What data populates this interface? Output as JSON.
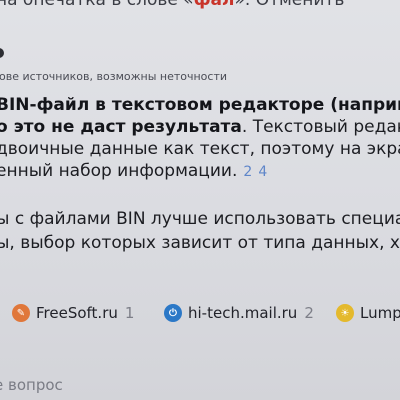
{
  "spellcheck": {
    "prefix": "на опечатка в слове «",
    "word": "фал",
    "suffix": "». ",
    "undo": "Отменить"
  },
  "disclaimer": "ове источников, возможны неточности",
  "answer": {
    "line1_bold": "BIN-файл в текстовом редакторе (например, «Бл",
    "line2_bold": "о это не даст результата",
    "line2_rest": ". Текстовый редактор поп",
    "line3": "двоичные данные как текст, поэтому на экране по",
    "line4": "енный набор информации.",
    "refs": [
      "2",
      "4"
    ]
  },
  "para2": {
    "line1": "ы с файлами BIN лучше использовать специализи",
    "line2": "ы, выбор которых зависит от типа данных, храним"
  },
  "sources": [
    {
      "name": "FreeSoft.ru",
      "count": "1",
      "icon": "freesoft-icon",
      "color": "#e0773a"
    },
    {
      "name": "hi-tech.mail.ru",
      "count": "2",
      "icon": "mail-icon",
      "color": "#2b78c7"
    },
    {
      "name": "Lump",
      "count": "",
      "icon": "lumpics-icon",
      "color": "#e4b92c"
    }
  ],
  "ask_question": "е вопрос"
}
